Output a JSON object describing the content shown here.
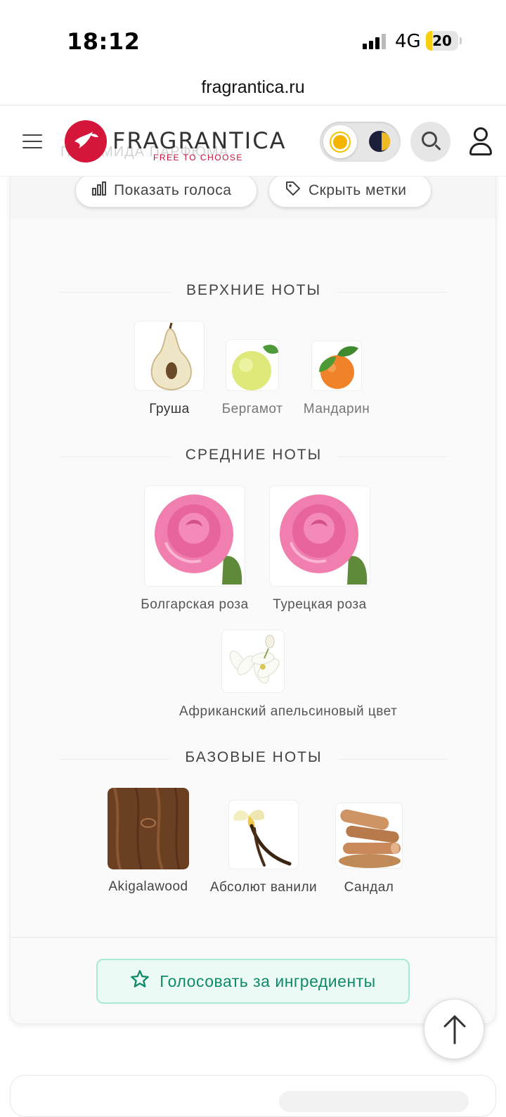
{
  "status_bar": {
    "time": "18:12",
    "network": "4G",
    "battery": "20",
    "battery_level": 0.2
  },
  "browser": {
    "url": "fragrantica.ru"
  },
  "header": {
    "logo_text": "FRAGRANTICA",
    "logo_tagline": "FREE TO CHOOSE",
    "overlay_text": "ПИРАМИДА ПАРФЮМА"
  },
  "toolbar": {
    "show_votes_label": "Показать голоса",
    "hide_tags_label": "Скрыть метки"
  },
  "pyramid": {
    "top": {
      "title": "ВЕРХНИЕ НОТЫ",
      "notes": [
        {
          "name": "Груша",
          "icon": "pear-icon"
        },
        {
          "name": "Бергамот",
          "icon": "bergamot-icon"
        },
        {
          "name": "Мандарин",
          "icon": "mandarin-icon"
        }
      ]
    },
    "middle": {
      "title": "СРЕДНИЕ НОТЫ",
      "notes": [
        {
          "name": "Болгарская роза",
          "icon": "rose-icon"
        },
        {
          "name": "Турецкая роза",
          "icon": "rose-icon"
        },
        {
          "name": "Африканский апельсиновый цвет",
          "icon": "orange-blossom-icon"
        }
      ]
    },
    "base": {
      "title": "БАЗОВЫЕ НОТЫ",
      "notes": [
        {
          "name": "Akigalawood",
          "icon": "wood-icon"
        },
        {
          "name": "Абсолют ванили",
          "icon": "vanilla-icon"
        },
        {
          "name": "Сандал",
          "icon": "sandalwood-icon"
        }
      ]
    }
  },
  "vote_button": {
    "label": "Голосовать за ингредиенты"
  },
  "colors": {
    "brand_red": "#d4163b",
    "vote_green": "#0e8a69",
    "vote_bg": "#ecfaf5"
  }
}
